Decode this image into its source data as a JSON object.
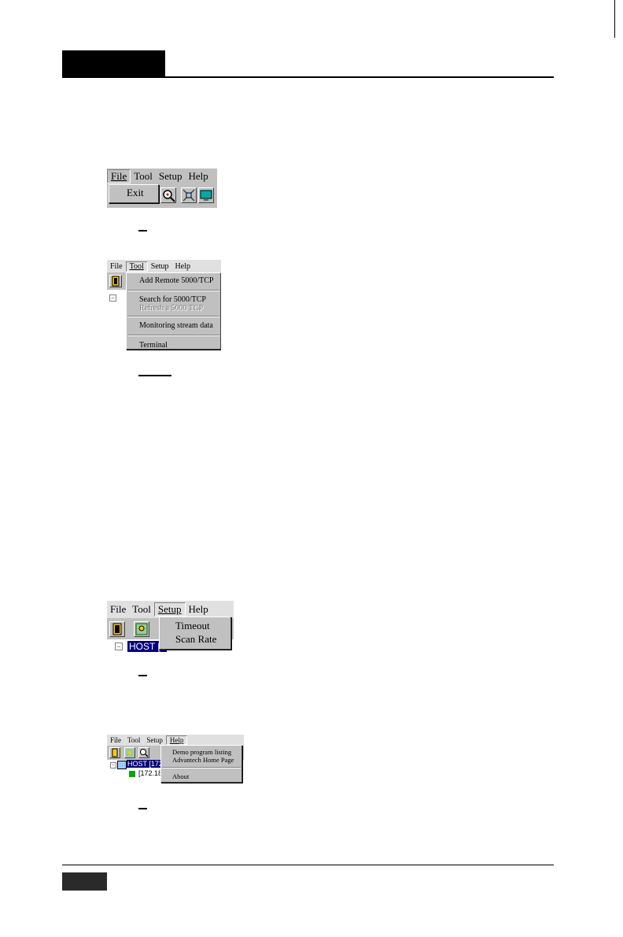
{
  "shot1": {
    "menu": [
      "File",
      "Tool",
      "Setup",
      "Help"
    ],
    "dropdown": [
      "Exit"
    ]
  },
  "shot2": {
    "menu": [
      "File",
      "Tool",
      "Setup",
      "Help"
    ],
    "dropdown": [
      "Add Remote 5000/TCP",
      "Search for 5000/TCP",
      "Refresh a 5000 TCP",
      "Monitoring stream data",
      "Terminal"
    ]
  },
  "shot3": {
    "menu": [
      "File",
      "Tool",
      "Setup",
      "Help"
    ],
    "dropdown": [
      "Timeout",
      "Scan Rate"
    ],
    "tree_host": "HOST [1"
  },
  "shot4": {
    "menu": [
      "File",
      "Tool",
      "Setup",
      "Help"
    ],
    "dropdown": [
      "Demo program listing",
      "Advantech Home Page",
      "About"
    ],
    "tree_host": "HOST [172",
    "tree_child": "[172.18."
  }
}
